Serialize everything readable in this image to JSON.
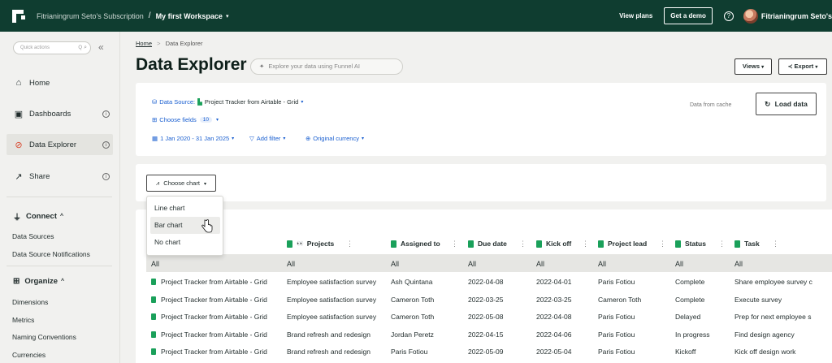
{
  "topbar": {
    "subscription": "Fitrianingrum Seto's Subscription",
    "separator": "/",
    "workspace": "My first Workspace",
    "view_plans": "View plans",
    "get_demo": "Get a demo",
    "help": "?",
    "user": "Fitrianingrum Seto's"
  },
  "sidebar": {
    "quick_actions_placeholder": "Quick actions",
    "quick_actions_key": "Q",
    "collapse": "«",
    "items": [
      {
        "label": "Home"
      },
      {
        "label": "Dashboards"
      },
      {
        "label": "Data Explorer"
      },
      {
        "label": "Share"
      }
    ],
    "connect": {
      "label": "Connect",
      "items": [
        "Data Sources",
        "Data Source Notifications"
      ]
    },
    "organize": {
      "label": "Organize",
      "items": [
        "Dimensions",
        "Metrics",
        "Naming Conventions",
        "Currencies"
      ]
    }
  },
  "breadcrumb": {
    "home": "Home",
    "sep": ">",
    "current": "Data Explorer"
  },
  "page_title": "Data Explorer",
  "ai_search_placeholder": "Explore your data using Funnel AI",
  "views_button": "Views",
  "export_button": "Export",
  "controls": {
    "data_source_label": "Data Source:",
    "data_source_value": "Project Tracker from Airtable - Grid",
    "choose_fields": "Choose fields",
    "fields_count": "10",
    "date_range": "1 Jan 2020 - 31 Jan 2025",
    "add_filter": "Add filter",
    "currency": "Original currency",
    "cache_note": "Data from cache",
    "load_data": "Load data"
  },
  "chart": {
    "choose_chart": "Choose chart",
    "options": [
      "Line chart",
      "Bar chart",
      "No chart"
    ]
  },
  "table": {
    "columns": [
      "Projects",
      "Assigned to",
      "Due date",
      "Kick off",
      "Project lead",
      "Status",
      "Task"
    ],
    "projects_emoji": "👀",
    "filters": [
      "All",
      "All",
      "All",
      "All",
      "All",
      "All",
      "All",
      "All"
    ],
    "rows": [
      [
        "Project Tracker from Airtable - Grid",
        "Employee satisfaction survey",
        "Ash Quintana",
        "2022-04-08",
        "2022-04-01",
        "Paris Fotiou",
        "Complete",
        "Share employee survey c"
      ],
      [
        "Project Tracker from Airtable - Grid",
        "Employee satisfaction survey",
        "Cameron Toth",
        "2022-03-25",
        "2022-03-25",
        "Cameron Toth",
        "Complete",
        "Execute survey"
      ],
      [
        "Project Tracker from Airtable - Grid",
        "Employee satisfaction survey",
        "Cameron Toth",
        "2022-05-08",
        "2022-04-08",
        "Paris Fotiou",
        "Delayed",
        "Prep for next employee s"
      ],
      [
        "Project Tracker from Airtable - Grid",
        "Brand refresh and redesign",
        "Jordan Peretz",
        "2022-04-15",
        "2022-04-06",
        "Paris Fotiou",
        "In progress",
        "Find design agency"
      ],
      [
        "Project Tracker from Airtable - Grid",
        "Brand refresh and redesign",
        "Paris Fotiou",
        "2022-05-09",
        "2022-05-04",
        "Paris Fotiou",
        "Kickoff",
        "Kick off design work"
      ]
    ]
  }
}
